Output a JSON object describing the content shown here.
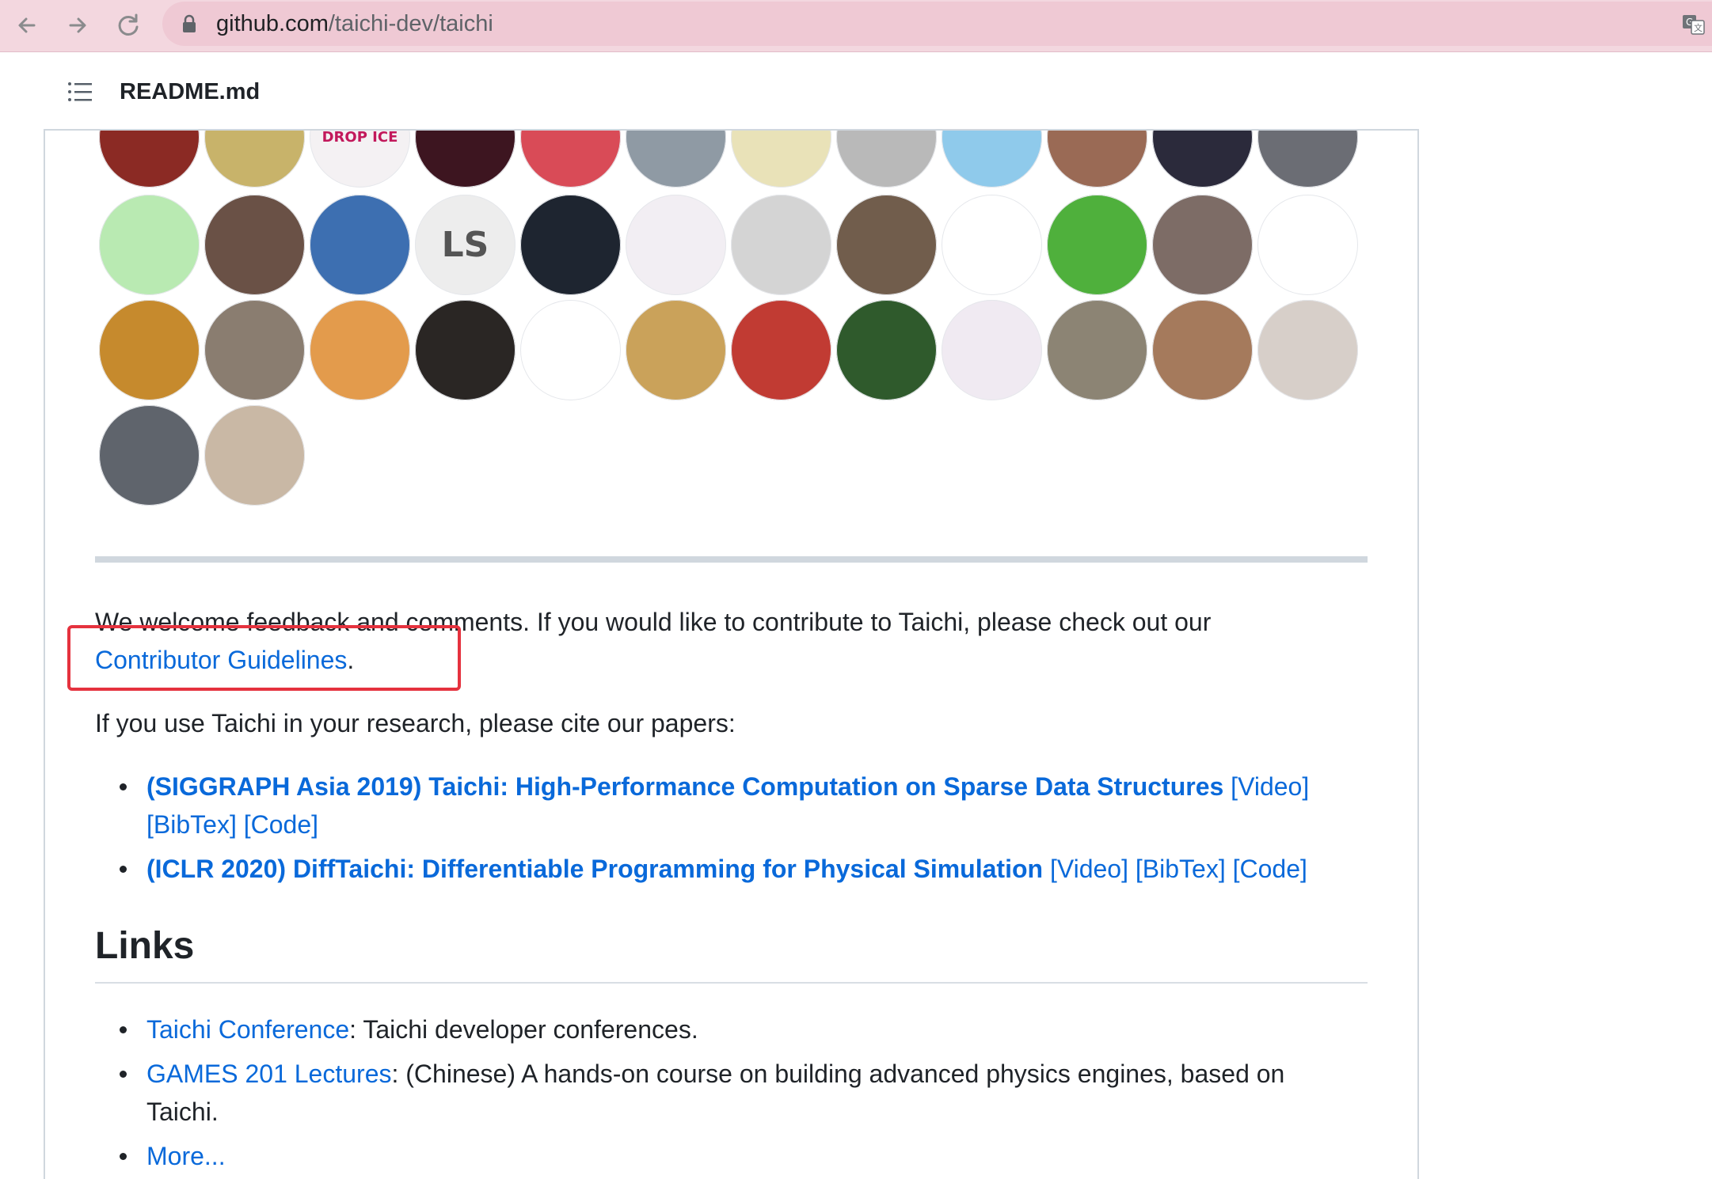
{
  "browser": {
    "url_host": "github.com",
    "url_path": "/taichi-dev/taichi",
    "icons": [
      "back-arrow-icon",
      "forward-arrow-icon",
      "reload-icon",
      "lock-icon",
      "translate-icon"
    ]
  },
  "readme": {
    "title": "README.md"
  },
  "contributors": {
    "avatars": [
      {
        "label": "",
        "bg": "#8b2a24"
      },
      {
        "label": "",
        "bg": "#c8b36a"
      },
      {
        "label": "DROP ICE",
        "bg": "#f4f1f3"
      },
      {
        "label": "",
        "bg": "#3d1520"
      },
      {
        "label": "",
        "bg": "#d94b57"
      },
      {
        "label": "",
        "bg": "#8f9aa4"
      },
      {
        "label": "",
        "bg": "#e9e2b8"
      },
      {
        "label": "",
        "bg": "#b9b9b9"
      },
      {
        "label": "",
        "bg": "#8fcaeb"
      },
      {
        "label": "",
        "bg": "#9a6a55"
      },
      {
        "label": "",
        "bg": "#2b2a3b"
      },
      {
        "label": "",
        "bg": "#6b6d74"
      },
      {
        "label": "",
        "bg": "#b9eab2"
      },
      {
        "label": "",
        "bg": "#6a5146"
      },
      {
        "label": "",
        "bg": "#3d6fb1"
      },
      {
        "label": "LS",
        "bg": "#ededed"
      },
      {
        "label": "",
        "bg": "#1e2530"
      },
      {
        "label": "",
        "bg": "#f2eef3"
      },
      {
        "label": "",
        "bg": "#d4d4d4"
      },
      {
        "label": "",
        "bg": "#715d4c"
      },
      {
        "label": "",
        "bg": "#ffffff"
      },
      {
        "label": "",
        "bg": "#4fb03c"
      },
      {
        "label": "",
        "bg": "#7d6c66"
      },
      {
        "label": "",
        "bg": "#ffffff"
      },
      {
        "label": "",
        "bg": "#c68a2d"
      },
      {
        "label": "",
        "bg": "#8a7d70"
      },
      {
        "label": "",
        "bg": "#e39b4c"
      },
      {
        "label": "",
        "bg": "#2a2624"
      },
      {
        "label": "",
        "bg": "#ffffff"
      },
      {
        "label": "",
        "bg": "#caa25a"
      },
      {
        "label": "",
        "bg": "#c13b33"
      },
      {
        "label": "",
        "bg": "#2f5a2c"
      },
      {
        "label": "",
        "bg": "#f0eaf2"
      },
      {
        "label": "",
        "bg": "#8c8474"
      },
      {
        "label": "",
        "bg": "#a57a5c"
      },
      {
        "label": "",
        "bg": "#d7cfc9"
      },
      {
        "label": "",
        "bg": "#5f646c"
      },
      {
        "label": "",
        "bg": "#c9b8a5"
      }
    ]
  },
  "feedback": {
    "line1": "We welcome feedback and comments. If you would like to contribute to Taichi, please check out our",
    "link": "Contributor Guidelines",
    "period": "."
  },
  "cite": {
    "intro": "If you use Taichi in your research, please cite our papers:",
    "papers": [
      {
        "title": "(SIGGRAPH Asia 2019) Taichi: High-Performance Computation on Sparse Data Structures",
        "video": "[Video]",
        "bibtex": "[BibTex]",
        "code": "[Code]"
      },
      {
        "title": "(ICLR 2020) DiffTaichi: Differentiable Programming for Physical Simulation",
        "video": "[Video]",
        "bibtex": "[BibTex]",
        "code": "[Code]"
      }
    ]
  },
  "links": {
    "heading": "Links",
    "items": [
      {
        "link": "Taichi Conference",
        "text": ": Taichi developer conferences."
      },
      {
        "link": "GAMES 201 Lectures",
        "text": ": (Chinese) A hands-on course on building advanced physics engines, based on",
        "text2": "Taichi."
      },
      {
        "link": "More...",
        "text": ""
      }
    ]
  }
}
